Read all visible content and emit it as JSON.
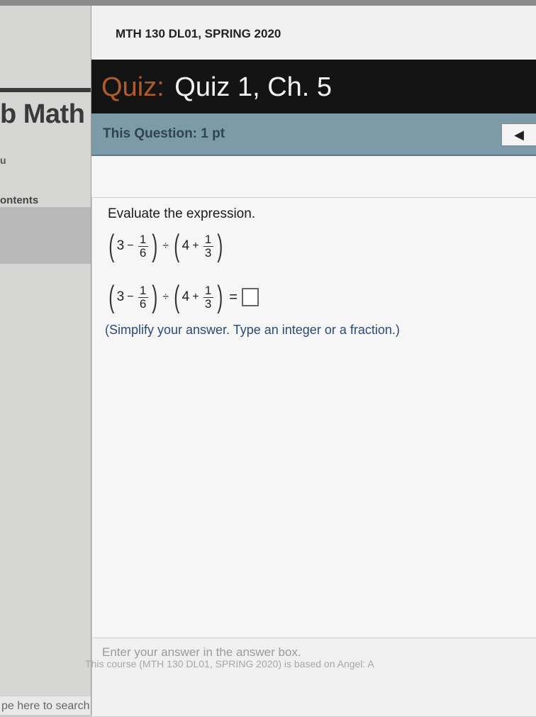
{
  "background": {
    "app_title_fragment": "b Math",
    "nav_glyph": "u",
    "contents_label": "ontents",
    "search_placeholder": "pe here to search"
  },
  "course": {
    "title": "MTH 130 DL01, SPRING 2020"
  },
  "quiz": {
    "label": "Quiz:",
    "name": "Quiz 1, Ch. 5"
  },
  "question": {
    "label": "This Question: 1 pt",
    "prev_icon": "chevron-left-icon",
    "prompt": "Evaluate the expression.",
    "expression": {
      "a": "3",
      "op1": "−",
      "f1_num": "1",
      "f1_den": "6",
      "div": "÷",
      "b": "4",
      "op2": "+",
      "f2_num": "1",
      "f2_den": "3",
      "equals": "="
    },
    "hint": "(Simplify your answer. Type an integer or a fraction.)",
    "answer_value": ""
  },
  "answer_area": {
    "instruction": "Enter your answer in the answer box."
  },
  "footer": {
    "text": "This course (MTH 130 DL01, SPRING 2020) is based on Angel: A"
  },
  "colors": {
    "quiz_bar_bg": "#141414",
    "quiz_label": "#b15a2a",
    "question_bar_bg": "#7d9aa8",
    "hint_text": "#2b4a78"
  }
}
